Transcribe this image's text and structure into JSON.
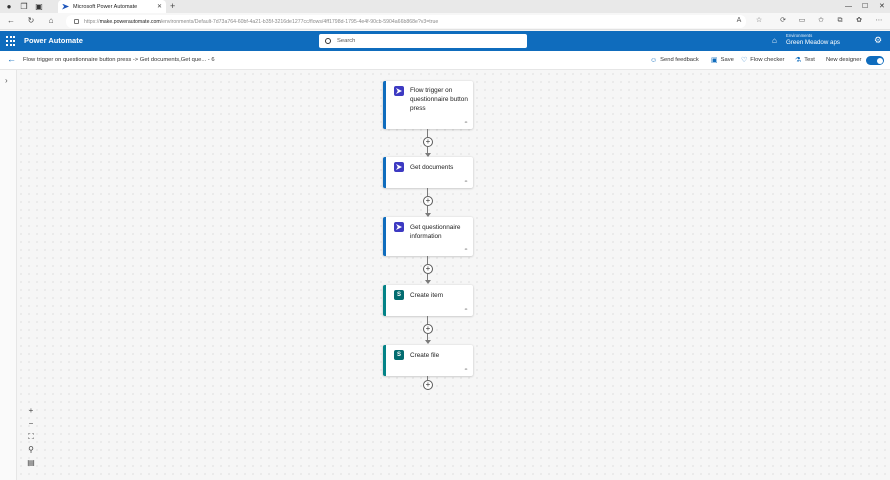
{
  "browser": {
    "tab_title": "Microsoft Power Automate",
    "url_host": "make.powerautomate.com",
    "url_path": "/environments/Default-7d73a764-60bf-4a21-b35f-3216de1277cc/flows/4ff1798d-1795-4e4f-90cb-5904a66b868e?v3=true"
  },
  "header": {
    "app_name": "Power Automate",
    "search_placeholder": "Search",
    "environment_label": "Environments",
    "environment_name": "Green Meadow aps"
  },
  "commandbar": {
    "breadcrumb": "Flow trigger on questionnaire button press -> Get documents,Get que... - 6",
    "send_feedback": "Send feedback",
    "save": "Save",
    "flow_checker": "Flow checker",
    "test": "Test",
    "new_designer": "New designer",
    "new_designer_on": true
  },
  "flow": {
    "steps": [
      {
        "title": "Flow trigger on questionnaire button press",
        "icon": "power-automate-icon",
        "connector_color": "#0f6cbd"
      },
      {
        "title": "Get documents",
        "icon": "power-automate-icon",
        "connector_color": "#0f6cbd"
      },
      {
        "title": "Get questionnaire information",
        "icon": "power-automate-icon",
        "connector_color": "#0f6cbd"
      },
      {
        "title": "Create item",
        "icon": "sharepoint-icon",
        "connector_color": "#038387"
      },
      {
        "title": "Create file",
        "icon": "sharepoint-icon",
        "connector_color": "#038387"
      }
    ]
  },
  "colors": {
    "brand": "#0f6cbd",
    "sharepoint": "#038387",
    "trigger_icon": "#3d3ac2"
  }
}
